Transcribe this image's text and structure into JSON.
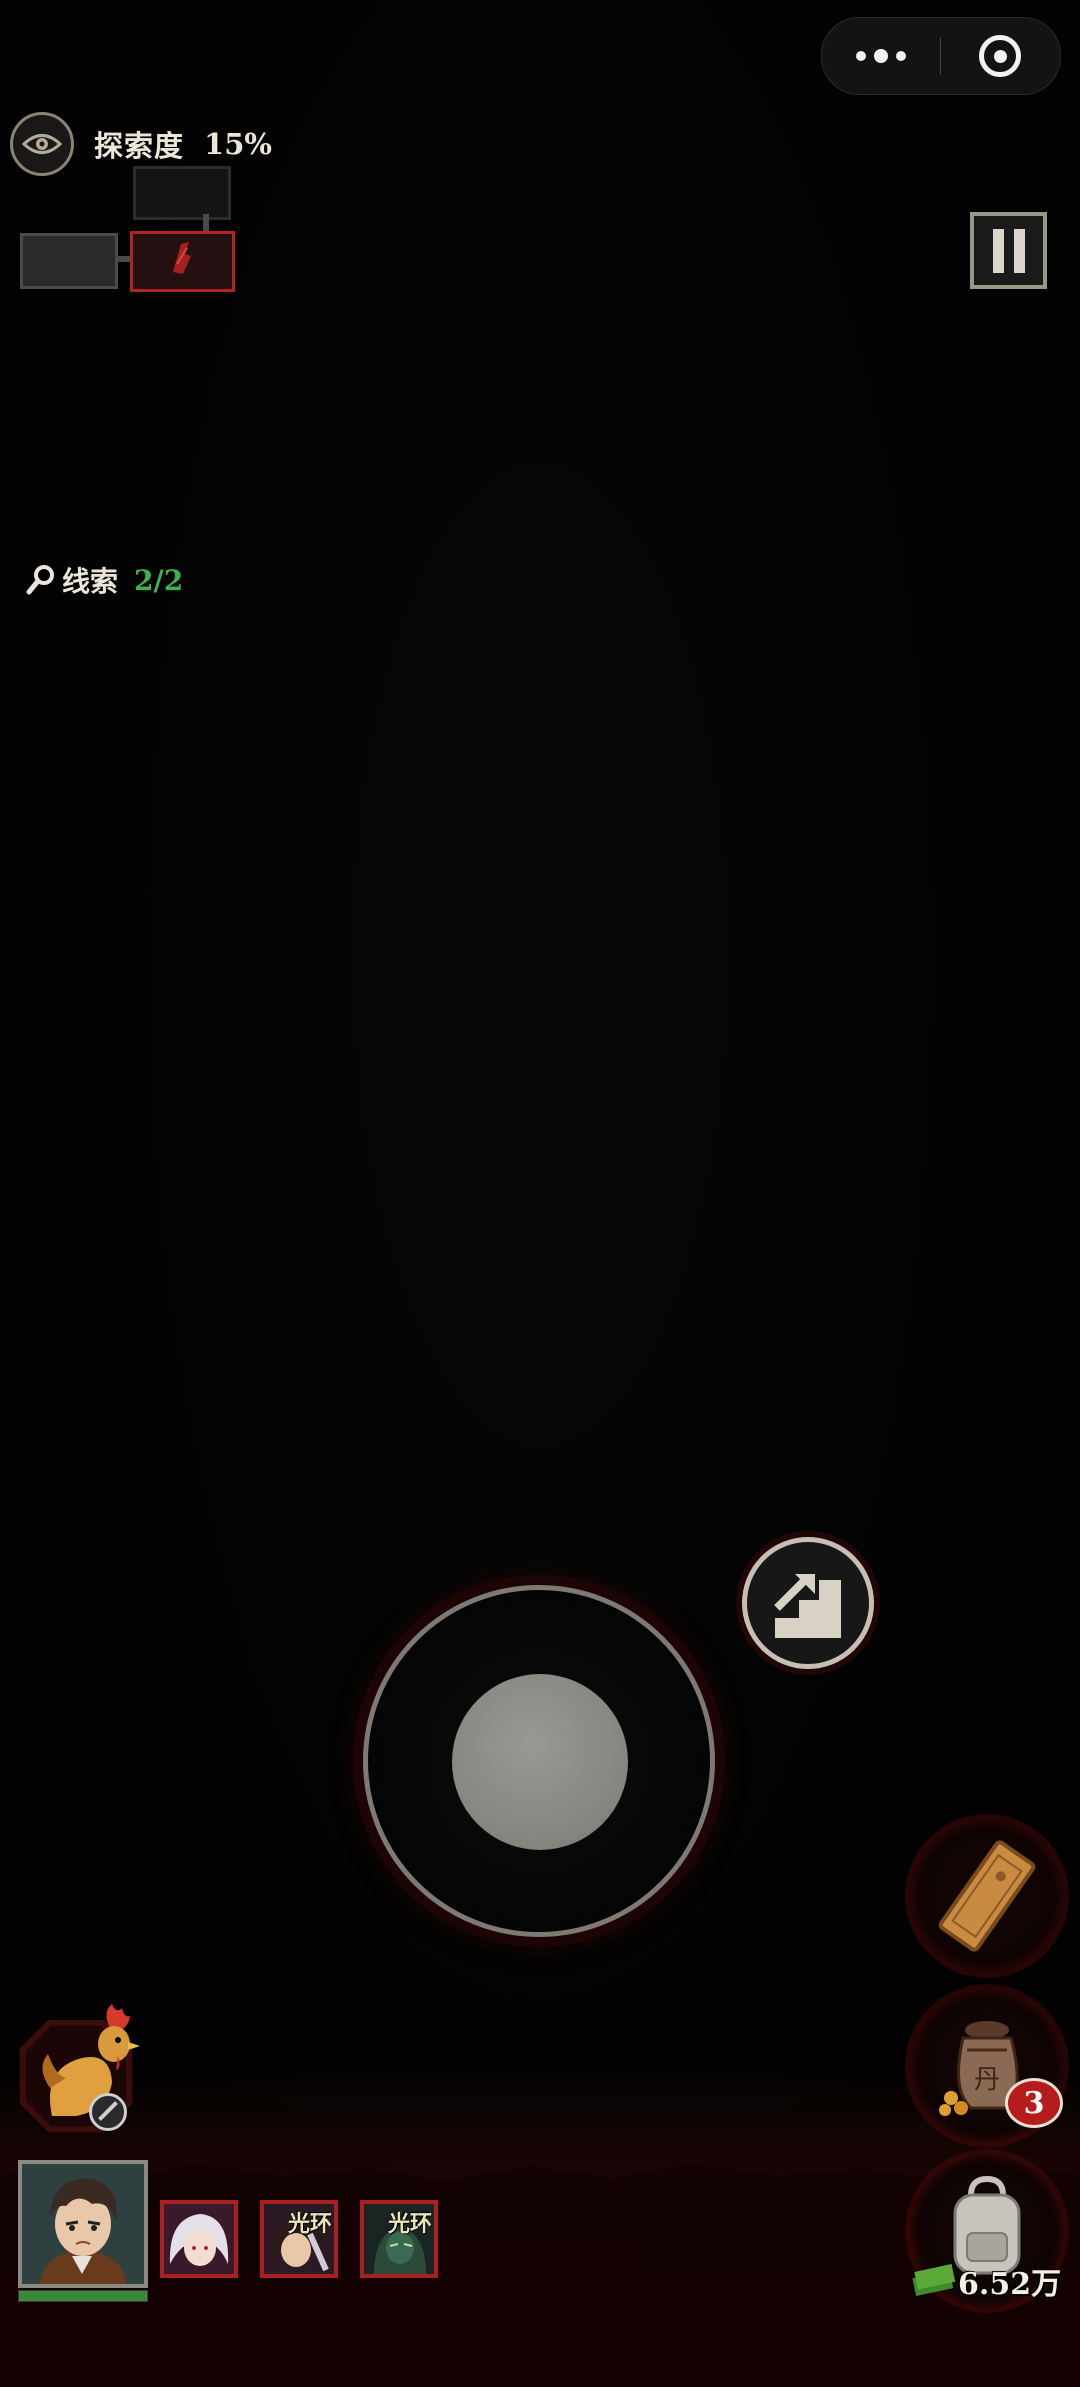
{
  "wechat_capsule": {
    "more_icon": "more-dots-icon",
    "close_icon": "target-close-icon"
  },
  "hud": {
    "exploration_label": "探索度",
    "exploration_value": "15%",
    "clue_label": "线索",
    "clue_value": "2/2",
    "clue_value_color": "#3fb34a",
    "minimap_current_room_color": "#b22424"
  },
  "controls": {
    "pause_icon": "pause-icon",
    "stairs_icon": "stairs-icon",
    "joystick": "virtual-joystick"
  },
  "inventory": {
    "token_icon": "wooden-token-icon",
    "potion_icon": "potion-bag-icon",
    "potion_count": "3",
    "backpack_icon": "backpack-icon",
    "money": "6.52万"
  },
  "party": {
    "hero_portrait": "hero-portrait",
    "pet_icon": "rooster-icon",
    "skills": [
      {
        "name": "white-haired-ally",
        "tag": ""
      },
      {
        "name": "dark-haired-ally",
        "tag": "光环"
      },
      {
        "name": "green-masked-ally",
        "tag": "光环"
      }
    ]
  }
}
